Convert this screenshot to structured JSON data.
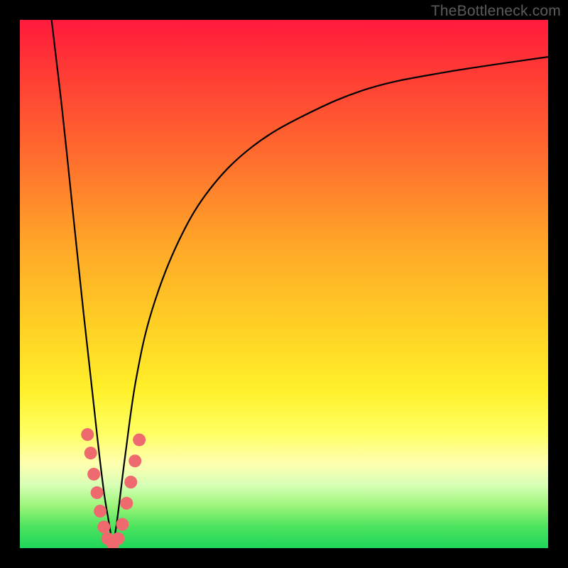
{
  "watermark": "TheBottleneck.com",
  "colors": {
    "frame": "#000000",
    "curve": "#000000",
    "dot": "#ee6a6e",
    "gradient_stops": [
      "#ff1a3c",
      "#ff3b35",
      "#ff6a2e",
      "#ffa528",
      "#ffd024",
      "#fff02a",
      "#ffff60",
      "#feffb0",
      "#d8ffb6",
      "#9cf57a",
      "#4be35e",
      "#1fd65a"
    ]
  },
  "chart_data": {
    "type": "line",
    "title": "",
    "xlabel": "",
    "ylabel": "",
    "xlim": [
      0,
      100
    ],
    "ylim": [
      0,
      100
    ],
    "grid": false,
    "annotations": [
      "TheBottleneck.com"
    ],
    "series": [
      {
        "name": "left-branch",
        "x": [
          6,
          8,
          10,
          12,
          14,
          15,
          16,
          17,
          17.6
        ],
        "y": [
          100,
          83,
          64,
          45,
          27,
          18,
          10,
          4,
          0
        ]
      },
      {
        "name": "right-branch",
        "x": [
          17.6,
          18.5,
          20,
          22,
          25,
          30,
          36,
          44,
          54,
          66,
          80,
          100
        ],
        "y": [
          0,
          6,
          18,
          32,
          45,
          58,
          68,
          76,
          82,
          87,
          90,
          93
        ]
      }
    ],
    "scatter": {
      "name": "highlight-dots",
      "points": [
        {
          "x": 12.8,
          "y": 21.5
        },
        {
          "x": 13.4,
          "y": 18.0
        },
        {
          "x": 14.0,
          "y": 14.0
        },
        {
          "x": 14.6,
          "y": 10.5
        },
        {
          "x": 15.2,
          "y": 7.0
        },
        {
          "x": 15.9,
          "y": 4.0
        },
        {
          "x": 16.6,
          "y": 1.8
        },
        {
          "x": 17.6,
          "y": 0.8
        },
        {
          "x": 18.6,
          "y": 1.8
        },
        {
          "x": 19.4,
          "y": 4.5
        },
        {
          "x": 20.2,
          "y": 8.5
        },
        {
          "x": 21.0,
          "y": 12.5
        },
        {
          "x": 21.8,
          "y": 16.5
        },
        {
          "x": 22.6,
          "y": 20.5
        }
      ]
    }
  }
}
